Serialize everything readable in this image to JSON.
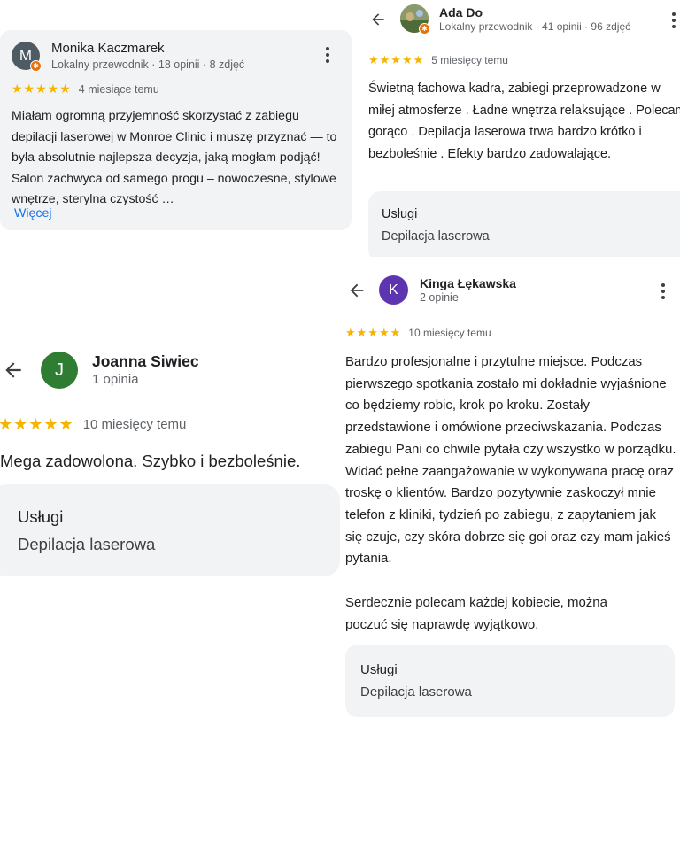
{
  "review1": {
    "avatar_letter": "M",
    "avatar_color": "#4f5b62",
    "name": "Monika Kaczmarek",
    "meta": "Lokalny przewodnik · 18 opinii · 8 zdjęć",
    "stars": "★★★★★",
    "time": "4 miesiące temu",
    "text": "Miałam ogromną przyjemność skorzystać z zabiegu depilacji laserowej w Monroe Clinic i muszę przyznać — to była absolutnie najlepsza decyzja, jaką mogłam podjąć! Salon zachwyca od samego progu – nowoczesne, stylowe wnętrze, sterylna czystość …",
    "more": "Więcej"
  },
  "review2": {
    "name": "Ada Do",
    "meta": "Lokalny przewodnik · 41 opinii · 96 zdjęć",
    "stars": "★★★★★",
    "time": "5 miesięcy temu",
    "text": "Świetną fachowa kadra, zabiegi przeprowadzone w miłej atmosferze . Ładne wnętrza relaksujące . Polecam gorąco . Depilacja laserowa trwa bardzo krótko i bezboleśnie . Efekty bardzo zadowalające.",
    "services_heading": "Usługi",
    "services_value": "Depilacja laserowa"
  },
  "review3": {
    "avatar_letter": "J",
    "avatar_color": "#2e7d32",
    "name": "Joanna Siwiec",
    "meta": "1 opinia",
    "stars": "★★★★★",
    "time": "10 miesięcy temu",
    "text": "Mega zadowolona. Szybko i bezboleśnie.",
    "services_heading": "Usługi",
    "services_value": "Depilacja laserowa"
  },
  "review4": {
    "avatar_letter": "K",
    "avatar_color": "#5e35b1",
    "name": "Kinga Łękawska",
    "meta": "2 opinie",
    "stars": "★★★★★",
    "time": "10 miesięcy temu",
    "text": "Bardzo profesjonalne i przytulne miejsce. Podczas pierwszego spotkania zostało mi dokładnie wyjaśnione co będziemy robic, krok po kroku. Zostały przedstawione i omówione przeciwskazania. Podczas zabiegu Pani co chwile pytała czy wszystko w porządku. Widać pełne zaangażowanie w wykonywana pracę oraz troskę o klientów. Bardzo pozytywnie zaskoczył mnie telefon z kliniki, tydzień po zabiegu, z zapytaniem jak się czuje, czy skóra dobrze się goi oraz czy mam jakieś pytania.",
    "text2": "Serdecznie polecam każdej kobiecie, można poczuć się naprawdę wyjątkowo.",
    "services_heading": "Usługi",
    "services_value": "Depilacja laserowa"
  }
}
